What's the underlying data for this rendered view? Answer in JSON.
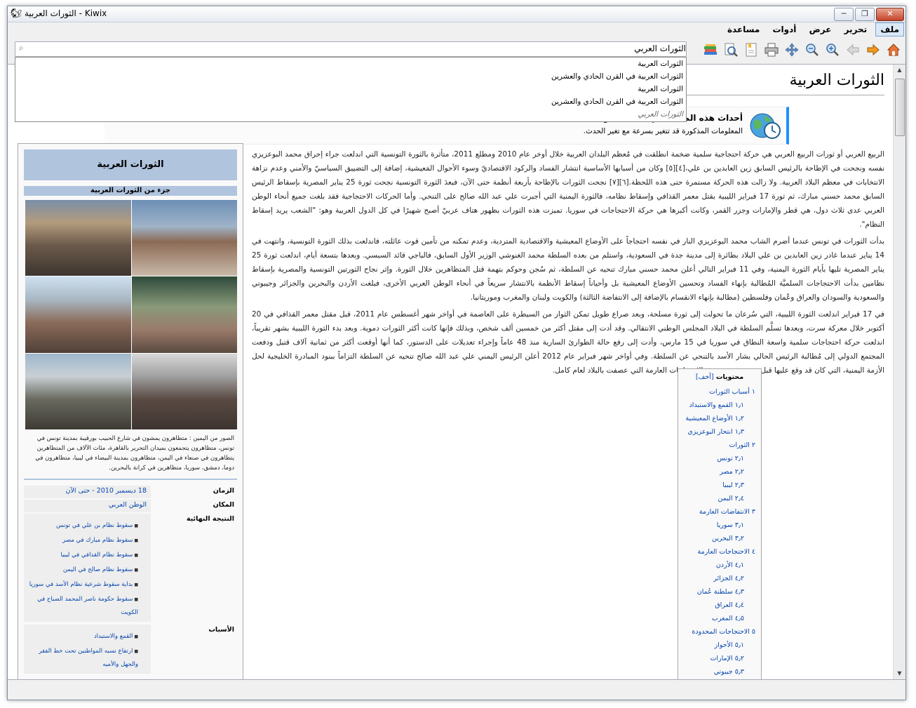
{
  "window": {
    "title": "الثورات العربية - Kiwix"
  },
  "menu": [
    "ملف",
    "تحرير",
    "عرض",
    "أدوات",
    "مساعدة"
  ],
  "search": {
    "value": "الثورات العربي"
  },
  "suggestions": [
    "الثورات العربية",
    "الثورات العربية في القرن الحادي والعشرين",
    "الثورات العربية",
    "الثورات العربية في القرن الحادي والعشرين",
    "الثورات العربي"
  ],
  "toolbar_icons": [
    "home-icon",
    "forward-icon",
    "back-icon",
    "zoom-in-icon",
    "zoom-out-icon",
    "fullscreen-icon",
    "print-icon",
    "bookmark-icon",
    "find-in-page-icon",
    "library-icon"
  ],
  "page": {
    "title": "الثورات العربية",
    "notice_title": "أحداث هذه المقالة هي أحداث جارية.",
    "notice_sub": "المعلومات المذكورة قد تتغير بسرعة مع تغير الحدث.",
    "paragraphs": [
      "الربيع العربي أو ثورات الربيع العربي هي حركة احتجاجية سلمية ضخمة انطلقت في مُعظم البلدان العربية خلال أوخر عام 2010 ومطلع 2011، متأثرة بالثورة التونسية التي اندلعت جراء إحراق محمد البوعزيزي نفسه ونجحت في الإطاحة بالرئيس السابق زين العابدين بن علي،[٤][٥] وكان من أسبابها الأساسية انتشار الفساد والركود الاقتصاديّ وسوء الأحوال المَعيشية، إضافة إلى التضييق السياسيّ والأمني وعدم نزاهة الانتخابات في معظم البلاد العربية. ولا زالت هذه الحركة مستمرة حتى هذه اللحظة.[٦][٧] نجحت الثورات بالإطاحة بأربعة أنظمة حتى الآن، فبعدَ الثورة التونسية نجحت ثورة 25 يناير المصرية بإسقاط الرئيس السابق محمد حسني مبارك، ثم ثورة 17 فبراير الليبية بقتل معمر القذافي وإسقاط نظامه، فالثورة اليمنية التي أجبرت علي عبد الله صالح على التنحي. وأما الحركات الاحتجاجية فقد بلغت جميع أنحاء الوطن العربي عدى ثلاث دول، هي قطر والإمارات وجزر القمر، وكانت أكبرها هي حركة الاحتجاجات في سوريا. تميزت هذه الثورات بظهور هتاف عربيّ أصبح شهيرًا في كل الدول العربية وهو: \"الشعب يريد إسقاط النظام\".",
      "بدأت الثورات في تونس عندما أضرم الشاب محمد البوعزيزي النار في نفسه احتجاجاً على الأوضاع المعيشية والاقتصادية المتردية، وعدم تمكنه من تأمين قوت عائلته، فاندلعت بذلك الثورة التونسية، وانتهت في 14 يناير عندما غادر زين العابدين بن علي البلاد بطائرة إلى مدينة جدة في السعودية، واستلم من بعده السلطة محمد الغنوشي الوزير الأول السابق، فالباجي قائد السبسي. وبعدها بتسعة أيام، اندلعت ثورة 25 يناير المصرية تليها بأيام الثورة اليمنية، وفي 11 فبراير التالي أعلن محمد حسني مبارك تنحيه عن السلطة، ثم سُجن وحوكم بتهمة قتل المتظاهرين خلال الثورة. وإثر نجاح الثورتين التونسية والمصرية بإسقاط نظامين بدأت الاحتجاجات السلميَّة المُطالبة بإنهاء الفساد وتحسين الأوضاع المعيشية بل وأحياناً إسقاط الأنظمة بالانتشار سريعاً في أنحاء الوطن العربي الأخرى، فبلغت الأردن والبحرين والجزائر وجيبوتي والسعودية والسودان والعراق وعُمان وفلسطين (مطالبة بإنهاء الانقسام بالإضافة إلى الانتفاضة الثالثة) والكويت ولبنان والمغرب وموريتانيا.",
      "في 17 فبراير اندلعت الثورة الليبية، التي سُرعان ما تحولت إلى ثورة مسلحة، وبعد صراع طويل تمكن الثوار من السيطرة على العاصمة في أواخر شهر أغسطس عام 2011، قبل مقتل معمر القذافي في 20 أكتوبر خلال معركة سرت، وبعدها تسلَّم السلطة في البلاد المجلس الوطني الانتقالي. وقد أدت إلى مقتل أكثر من خمسين ألف شخص، وبذلك فإنها كانت أكثر الثورات دموية. وبعد بدء الثورة الليبية بشهر تقريباً، اندلعت حركة احتجاجات سلمية واسعة النطاق في سوريا في 15 مارس، وأدت إلى رفع حالة الطوارئ السارية منذ 48 عاماً وإجراء تعديلات على الدستور، كما أنها أوقعت أكثر من ثمانية آلاف قتيل ودفعت المجتمع الدولي إلى مُطالبة الرئيس الحالي بشار الأسد بالتنحي عن السلطة. وفي أواخر شهر فبراير عام 2012 أعلن الرئيس اليمني علي عبد الله صالح تنحيه عن السلطة التزاماً ببنود المبادرة الخليجية لحل الأزمة اليمنية، التي كان قد وقع عليها قبل بضعة شهور عقبَ الاحتجاجات العارمة التي عصفت بالبلاد لعام كامل."
    ]
  },
  "infobox": {
    "title": "الثورات العربية",
    "part_of": "جزء من الثورات العربية",
    "caption": "الصور من اليمين : متظاهرون يمشون في شارع الحبيب بورقيبة بمدينة تونس في تونس، متظاهرون يتجمعون بميدان التحرير بالقاهرة، مئات الآلاف من المتظاهرين يتظاهرون في صنعاء في اليمن، متظاهرون بمدينة البيضاء في ليبيا، متظاهرون في دوما، دمشق، سوريا، متظاهرين في كرانة بالبحرين.",
    "date_label": "الزمان",
    "date_value": "18 ديسمبر 2010 - حتى الآن",
    "place_label": "المكان",
    "place_value": "الوطن العربي",
    "result_label": "النتيجة النهائية",
    "results": [
      "سقوط نظام بن علي في تونس",
      "سقوط نظام مبارك في مصر",
      "سقوط نظام القذافي في ليبيا",
      "سقوط نظام صالح في اليمن",
      "بداية سقوط شرعية نظام الأسد في سوريا",
      "سقوط حكومة ناصر المحمد الصباح في الكويت"
    ],
    "causes_label": "الأسباب",
    "causes": [
      "القمع والاستبداد",
      "ارتفاع نسبه المواطنين تحت خط الفقر والجهل والأميه"
    ]
  },
  "toc": {
    "title": "محتويات",
    "hide": "[أخف]",
    "items": [
      {
        "level": 1,
        "text": "١ أسباب الثورات"
      },
      {
        "level": 2,
        "text": "١٫١ القمع والاستبداد"
      },
      {
        "level": 2,
        "text": "١٫٢ الأوضاع المعيشية"
      },
      {
        "level": 2,
        "text": "١٫٣ انتحار البوعزيزي"
      },
      {
        "level": 1,
        "text": "٢ الثورات"
      },
      {
        "level": 2,
        "text": "٢٫١ تونس"
      },
      {
        "level": 2,
        "text": "٢٫٢ مصر"
      },
      {
        "level": 2,
        "text": "٢٫٣ ليبيا"
      },
      {
        "level": 2,
        "text": "٢٫٤ اليمن"
      },
      {
        "level": 1,
        "text": "٣ الانتفاضات العارمة"
      },
      {
        "level": 2,
        "text": "٣٫١ سوريا"
      },
      {
        "level": 2,
        "text": "٣٫٢ البحرين"
      },
      {
        "level": 1,
        "text": "٤ الاحتجاجات العارمة"
      },
      {
        "level": 2,
        "text": "٤٫١ الأردن"
      },
      {
        "level": 2,
        "text": "٤٫٢ الجزائر"
      },
      {
        "level": 2,
        "text": "٤٫٣ سلطنة عُمان"
      },
      {
        "level": 2,
        "text": "٤٫٤ العراق"
      },
      {
        "level": 2,
        "text": "٤٫٥ المغرب"
      },
      {
        "level": 1,
        "text": "٥ الاحتجاجات المحدودة"
      },
      {
        "level": 2,
        "text": "٥٫١ الأحواز"
      },
      {
        "level": 2,
        "text": "٥٫٢ الإمارات"
      },
      {
        "level": 2,
        "text": "٥٫٣ جيبوتي"
      }
    ]
  }
}
